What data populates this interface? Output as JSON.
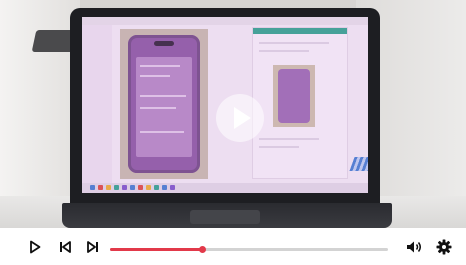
{
  "player": {
    "progress": 0.33,
    "accent_color": "#e2394a",
    "track_color": "#d3d3d3",
    "controls": {
      "play_icon": "play-icon",
      "previous_icon": "skip-previous-icon",
      "next_icon": "skip-next-icon",
      "volume_icon": "volume-icon",
      "settings_icon": "gear-icon"
    },
    "overlay": {
      "center_icon": "play-icon"
    }
  }
}
